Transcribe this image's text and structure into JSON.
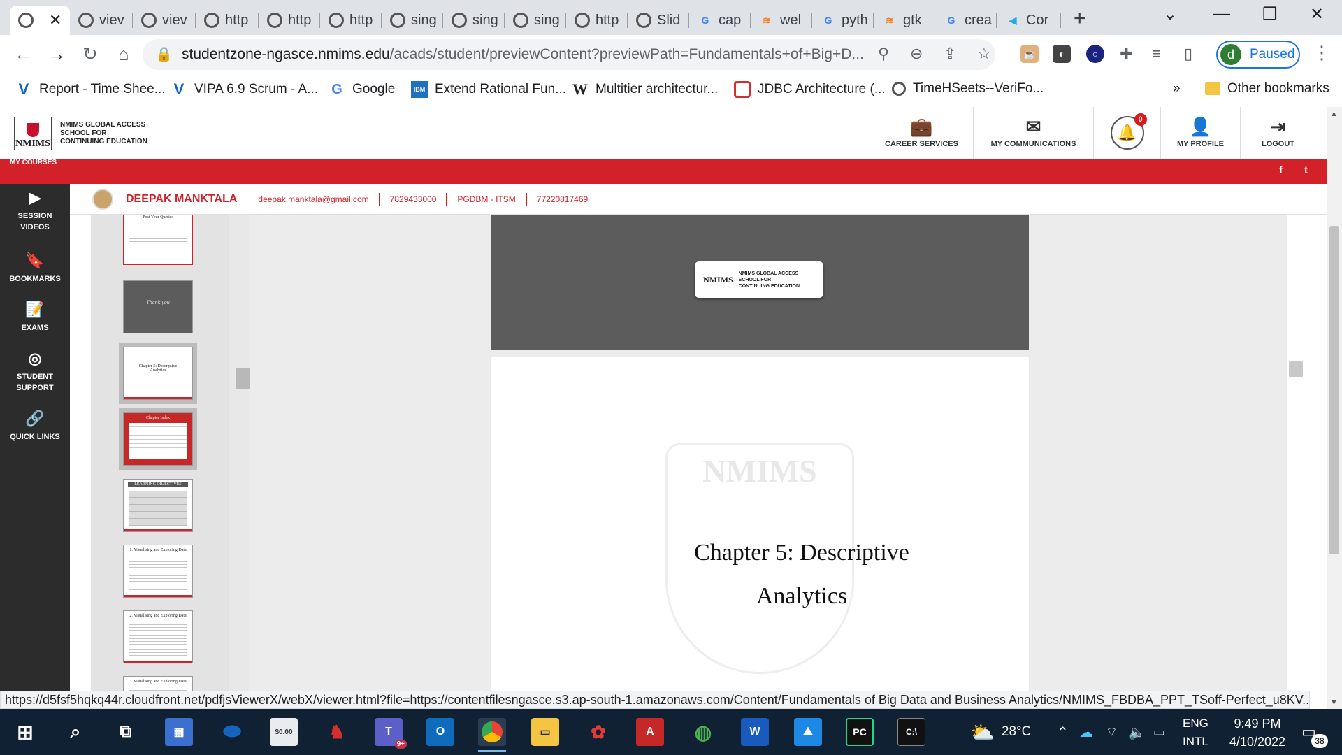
{
  "browser": {
    "tabs": [
      {
        "label": "",
        "icon": "globe-icon",
        "active": true
      },
      {
        "label": "viev",
        "icon": "globe-icon"
      },
      {
        "label": "viev",
        "icon": "globe-icon"
      },
      {
        "label": "http",
        "icon": "globe-icon"
      },
      {
        "label": "http",
        "icon": "globe-icon"
      },
      {
        "label": "http",
        "icon": "globe-icon"
      },
      {
        "label": "sing",
        "icon": "globe-icon"
      },
      {
        "label": "sing",
        "icon": "globe-icon"
      },
      {
        "label": "sing",
        "icon": "globe-icon"
      },
      {
        "label": "http",
        "icon": "globe-icon"
      },
      {
        "label": "Slid",
        "icon": "globe-icon"
      },
      {
        "label": "cap",
        "icon": "google-icon"
      },
      {
        "label": "wel",
        "icon": "stackoverflow-icon"
      },
      {
        "label": "pyth",
        "icon": "google-icon"
      },
      {
        "label": "gtk",
        "icon": "stackoverflow-icon"
      },
      {
        "label": "crea",
        "icon": "google-icon"
      },
      {
        "label": "Cor",
        "icon": "fish-icon"
      }
    ],
    "url_host": "studentzone-ngasce.nmims.edu",
    "url_path": "/acads/student/previewContent?previewPath=Fundamentals+of+Big+D...",
    "profile_initial": "d",
    "profile_status": "Paused",
    "bookmarks": [
      {
        "label": "Report - Time Shee...",
        "icon": "v-icon"
      },
      {
        "label": "VIPA 6.9 Scrum - A...",
        "icon": "v-icon"
      },
      {
        "label": "Google",
        "icon": "google-icon"
      },
      {
        "label": "Extend Rational Fun...",
        "icon": "ibm-icon"
      },
      {
        "label": "Multitier architectur...",
        "icon": "wikipedia-icon"
      },
      {
        "label": "JDBC Architecture (...",
        "icon": "oracle-icon"
      },
      {
        "label": "TimeHSeets--VeriFo...",
        "icon": "globe-icon"
      }
    ],
    "bookmarks_more": "»",
    "other_bookmarks": "Other bookmarks",
    "status_url": "https://d5fsf5hqkq44r.cloudfront.net/pdfjsViewerX/webX/viewer.html?file=https://contentfilesngasce.s3.ap-south-1.amazonaws.com/Content/Fundamentals of Big Data and Business Analytics/NMIMS_FBDBA_PPT_TSoff-Perfect_u8KV..."
  },
  "site": {
    "logo_mark": "NMIMS",
    "logo_line1": "NMIMS GLOBAL ACCESS",
    "logo_line2": "SCHOOL FOR",
    "logo_line3": "CONTINUING EDUCATION",
    "nav": [
      {
        "label": "CAREER SERVICES",
        "icon": "briefcase-icon"
      },
      {
        "label": "MY COMMUNICATIONS",
        "icon": "envelope-icon"
      },
      {
        "label": "MY PROFILE",
        "icon": "user-icon"
      },
      {
        "label": "LOGOUT",
        "icon": "logout-icon"
      }
    ],
    "notification_count": "0",
    "my_courses": "MY COURSES",
    "social": [
      "f",
      "t"
    ],
    "sidebar": [
      {
        "label_1": "SESSION",
        "label_2": "VIDEOS",
        "icon": "play-icon"
      },
      {
        "label_1": "BOOKMARKS",
        "label_2": "",
        "icon": "bookmark-icon"
      },
      {
        "label_1": "EXAMS",
        "label_2": "",
        "icon": "exam-icon"
      },
      {
        "label_1": "STUDENT",
        "label_2": "SUPPORT",
        "icon": "lifebuoy-icon"
      },
      {
        "label_1": "QUICK LINKS",
        "label_2": "",
        "icon": "link-icon"
      }
    ],
    "student": {
      "name": "DEEPAK MANKTALA",
      "email": "deepak.manktala@gmail.com",
      "phone": "7829433000",
      "program": "PGDBM - ITSM",
      "id": "77220817469"
    }
  },
  "viewer": {
    "thumbnails": [
      {
        "label": "Post Your Queries"
      },
      {
        "label": "Thank you"
      },
      {
        "label": "Chapter 5: Descriptive Analytics"
      },
      {
        "label": "Chapter Index"
      },
      {
        "label": "LEARNING OBJECTIVES"
      },
      {
        "label": "1. Visualising and Exploring Data"
      },
      {
        "label": "2. Visualising and Exploring Data"
      },
      {
        "label": "3. Visualising and Exploring Data"
      }
    ],
    "slide_card_mark": "NMIMS",
    "slide_card_line1": "NMIMS GLOBAL ACCESS",
    "slide_card_line2": "SCHOOL FOR",
    "slide_card_line3": "CONTINUING EDUCATION",
    "watermark": "NMIMS",
    "chapter_title_line1": "Chapter 5: Descriptive",
    "chapter_title_line2": "Analytics"
  },
  "taskbar": {
    "temperature": "28°C",
    "lang_1": "ENG",
    "lang_2": "INTL",
    "time": "9:49 PM",
    "date": "4/10/2022",
    "notifications": "38",
    "teams_badge": "9+"
  },
  "colors": {
    "brand_red": "#d3212a",
    "sidebar_bg": "#2c2c2c",
    "taskbar_bg": "#0f2133",
    "chrome_blue": "#1a73e8"
  }
}
